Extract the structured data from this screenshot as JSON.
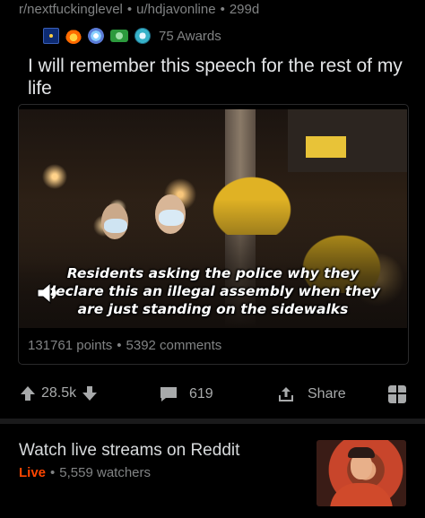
{
  "post": {
    "subreddit": "r/nextfuckinglevel",
    "author": "u/hdjavonline",
    "age": "299d",
    "awards_label": "75 Awards",
    "title": "I will remember this speech for the rest of my life",
    "subtitle_line1": "Residents asking the police why they",
    "subtitle_line2": "declare this an illegal assembly when they",
    "subtitle_line3": "are just standing on the sidewalks",
    "points": "131761 points",
    "comments": "5392 comments"
  },
  "actions": {
    "upvotes": "28.5k",
    "comment_count": "619",
    "share_label": "Share"
  },
  "live": {
    "title": "Watch live streams on Reddit",
    "badge": "Live",
    "watchers": "5,559 watchers"
  },
  "icons": [
    "award-flag-icon",
    "award-fire-icon",
    "award-star-icon",
    "award-cash-icon",
    "award-gem-icon",
    "sound-icon",
    "upvote-icon",
    "downvote-icon",
    "comment-icon",
    "share-icon",
    "gift-icon"
  ],
  "colors": {
    "accent_live": "#ff4500",
    "muted_text": "#818384",
    "primary_text": "#d7dadc"
  }
}
